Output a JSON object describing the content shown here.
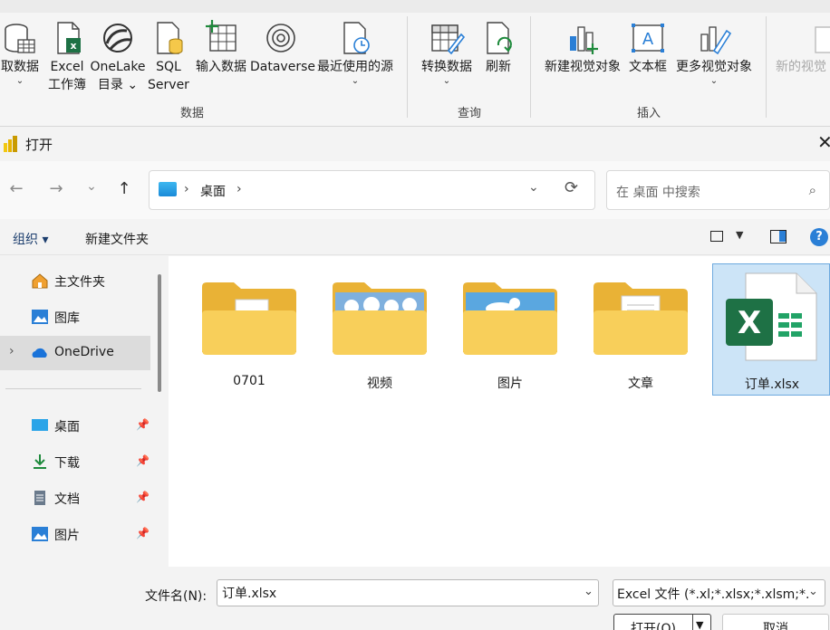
{
  "ribbon": {
    "groups": {
      "data": "数据",
      "query": "查询",
      "insert": "插入"
    },
    "buttons": {
      "get_data": "取数据",
      "excel_line1": "Excel",
      "excel_line2": "工作簿",
      "onelake_line1": "OneLake",
      "onelake_line2": "目录",
      "sql_line1": "SQL",
      "sql_line2": "Server",
      "enter_data": "输入数据",
      "dataverse": "Dataverse",
      "recent_sources": "最近使用的源",
      "transform_data": "转换数据",
      "refresh": "刷新",
      "new_visual": "新建视觉对象",
      "text_box": "文本框",
      "more_visuals": "更多视觉对象",
      "new_visual_calc": "新的视觉"
    }
  },
  "dialog": {
    "title": "打开",
    "close_glyph": "✕",
    "nav": {
      "back": "←",
      "forward": "→",
      "recent": "⌄",
      "up": "↑"
    },
    "address": {
      "chevron": "›",
      "location": "桌面",
      "chevron_end": "›",
      "dropdown": "⌄",
      "refresh": "⟳"
    },
    "search": {
      "placeholder": "在 桌面 中搜索",
      "icon": "⌕"
    },
    "toolbar": {
      "organize": "组织 ▾",
      "new_folder": "新建文件夹",
      "view_dropdown": "▼",
      "help": "?"
    },
    "sidebar": {
      "items": [
        {
          "label": "主文件夹"
        },
        {
          "label": "图库"
        },
        {
          "label": "OneDrive",
          "expand": "›"
        },
        {
          "label": "桌面",
          "pin": "📌"
        },
        {
          "label": "下载",
          "pin": "📌"
        },
        {
          "label": "文档",
          "pin": "📌"
        },
        {
          "label": "图片",
          "pin": "📌"
        }
      ]
    },
    "files": [
      {
        "name": "0701",
        "type": "folder"
      },
      {
        "name": "视频",
        "type": "folder"
      },
      {
        "name": "图片",
        "type": "folder"
      },
      {
        "name": "文章",
        "type": "folder"
      },
      {
        "name": "订单.xlsx",
        "type": "excel",
        "selected": true
      }
    ],
    "bottom": {
      "filename_label": "文件名(N):",
      "filename_value": "订单.xlsx",
      "filename_drop": "⌄",
      "filetype": "Excel 文件 (*.xl;*.xlsx;*.xlsm;*.",
      "filetype_drop": "⌄",
      "open": "打开(O)",
      "open_drop": "▼",
      "cancel": "取消"
    }
  },
  "colors": {
    "accent": "#2a7fd6",
    "folder": "#f5c84a",
    "excel_green": "#1e7145",
    "selection": "#cce4f7"
  }
}
